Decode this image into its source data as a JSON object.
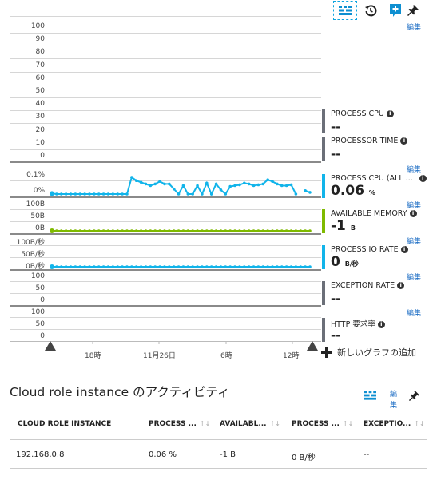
{
  "toolbar": {
    "grid_icon": "grid-icon",
    "history_icon": "history-icon",
    "add_chart_icon": "add-chart-icon",
    "pin_icon": "pin-icon",
    "edit_label": "編集"
  },
  "charts": {
    "processor_axis": [
      "100",
      "90",
      "80",
      "70",
      "60",
      "50",
      "40",
      "30",
      "20",
      "10",
      "0"
    ],
    "cpu_axis": [
      "0.1%",
      "0%"
    ],
    "memory_axis": [
      "100B",
      "50B",
      "0B"
    ],
    "io_axis": [
      "100B/秒",
      "50B/秒",
      "0B/秒"
    ],
    "exception_axis": [
      "100",
      "50",
      "0"
    ],
    "http_axis": [
      "100",
      "50",
      "0"
    ],
    "x_ticks": [
      "18時",
      "11月26日",
      "6時",
      "12時"
    ]
  },
  "chart_data": [
    {
      "type": "line",
      "title": "PROCESS CPU (ALL ...)",
      "ylabel": "",
      "ylim": [
        0,
        0.1
      ],
      "tick_labels": [
        "0%",
        "0.1%"
      ],
      "color": "#11b4ea",
      "values": [
        0.003,
        0,
        0,
        0,
        0,
        0,
        0,
        0,
        0,
        0,
        0,
        0,
        0,
        0,
        0,
        0,
        0,
        0.1,
        0.08,
        0.07,
        0.06,
        0.05,
        0.06,
        0.075,
        0.06,
        0.06,
        0.03,
        0,
        0.05,
        0,
        0,
        0.05,
        0,
        0.065,
        0,
        0.06,
        0.025,
        0,
        0.045,
        0.05,
        0.055,
        0.065,
        0.06,
        0.05,
        0.055,
        0.06,
        0.085,
        0.075,
        0.06,
        0.05,
        0.05,
        0.055,
        0,
        null,
        0.02,
        0.01
      ]
    },
    {
      "type": "line",
      "title": "AVAILABLE MEMORY",
      "ylim": [
        0,
        100
      ],
      "tick_labels": [
        "0B",
        "50B",
        "100B"
      ],
      "color": "#7fba00",
      "values_note": "flat at 0 across the range",
      "values": [
        0
      ]
    },
    {
      "type": "line",
      "title": "PROCESS IO RATE",
      "ylim": [
        0,
        100
      ],
      "tick_labels": [
        "0B/秒",
        "50B/秒",
        "100B/秒"
      ],
      "color": "#11b4ea",
      "values": [
        0
      ]
    }
  ],
  "metrics": [
    {
      "name": "PROCESS CPU",
      "value": "--",
      "unit": "",
      "color": "#6b6f78"
    },
    {
      "name": "PROCESSOR TIME",
      "value": "--",
      "unit": "",
      "color": "#6b6f78"
    },
    {
      "name": "PROCESS CPU (ALL ...",
      "value": "0.06",
      "unit": "%",
      "color": "#11b4ea"
    },
    {
      "name": "AVAILABLE MEMORY",
      "value": "-1",
      "unit": "B",
      "color": "#7fba00"
    },
    {
      "name": "PROCESS IO RATE",
      "value": "0",
      "unit": "B/秒",
      "color": "#11b4ea"
    },
    {
      "name": "EXCEPTION RATE",
      "value": "--",
      "unit": "",
      "color": "#6b6f78"
    },
    {
      "name": "HTTP 要求率",
      "value": "--",
      "unit": "",
      "color": "#6b6f78"
    }
  ],
  "add_chart_label": "新しいグラフの追加",
  "activity": {
    "title": "Cloud role instance のアクティビティ",
    "edit_label": "編集",
    "columns": [
      "CLOUD ROLE INSTANCE",
      "PROCESS ...",
      "AVAILABL...",
      "PROCESS ...",
      "EXCEPTIO..."
    ],
    "sort_glyph": "↑↓",
    "rows": [
      [
        "192.168.0.8",
        "0.06 %",
        "-1 B",
        "0 B/秒",
        "--"
      ]
    ]
  }
}
